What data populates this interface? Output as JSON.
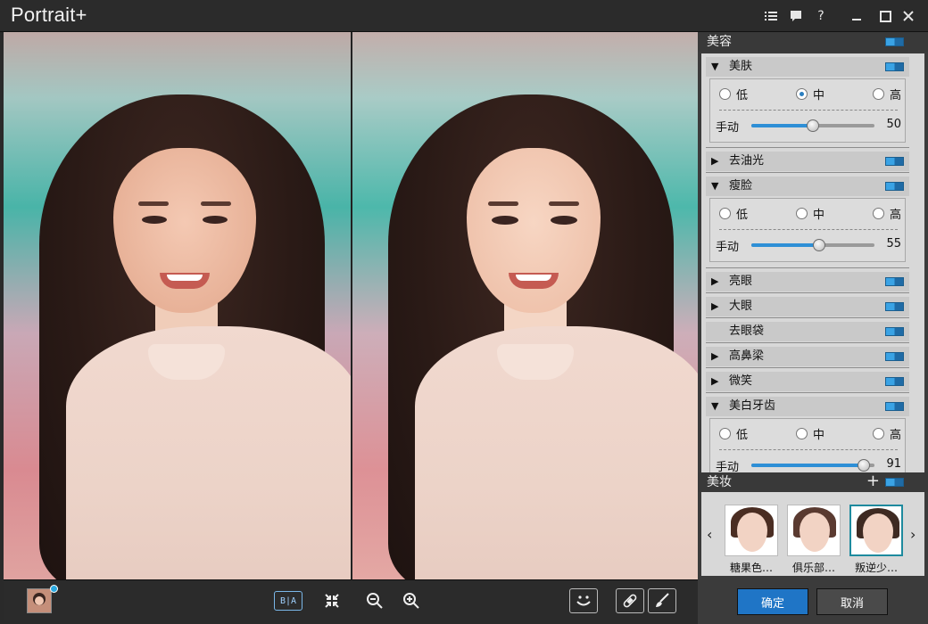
{
  "app": {
    "title": "Portrait+"
  },
  "titlebar": {
    "icons": [
      "list-icon",
      "chat-icon",
      "help-icon",
      "minimize-icon",
      "maximize-icon",
      "close-icon"
    ],
    "help": "?"
  },
  "panel": {
    "beauty_header": "美容",
    "items": [
      {
        "label": "美肤",
        "expanded": true,
        "levels": [
          "低",
          "中",
          "高"
        ],
        "selected": "中",
        "manual_label": "手动",
        "value": "50",
        "level": 50
      },
      {
        "label": "去油光",
        "expanded": false
      },
      {
        "label": "瘦脸",
        "expanded": true,
        "levels": [
          "低",
          "中",
          "高"
        ],
        "selected": null,
        "manual_label": "手动",
        "value": "55",
        "level": 55
      },
      {
        "label": "亮眼",
        "expanded": false
      },
      {
        "label": "大眼",
        "expanded": false
      },
      {
        "label": "去眼袋",
        "expanded": false,
        "no_arrow": true
      },
      {
        "label": "高鼻梁",
        "expanded": false
      },
      {
        "label": "微笑",
        "expanded": false
      },
      {
        "label": "美白牙齿",
        "expanded": true,
        "levels": [
          "低",
          "中",
          "高"
        ],
        "selected": null,
        "manual_label": "手动",
        "value": "91",
        "level": 91
      }
    ],
    "makeup_header": "美妆",
    "makeup_add": "+",
    "makeup_presets": [
      "糖果色…",
      "俱乐部…",
      "叛逆少…"
    ],
    "makeup_selected_index": 2,
    "ok_label": "确定",
    "cancel_label": "取消"
  },
  "bottombar": {
    "compare_label": "B|A",
    "tools": [
      "avatar-thumb",
      "compare-icon",
      "collapse-icon",
      "zoom-out-icon",
      "zoom-in-icon",
      "smile-icon",
      "bandage-icon",
      "brush-icon"
    ]
  },
  "colors": {
    "accent": "#2b7fc0",
    "ok_button": "#1f75c6",
    "cancel_button": "#4a4a4a",
    "panel_bg": "#d8d8d8"
  }
}
